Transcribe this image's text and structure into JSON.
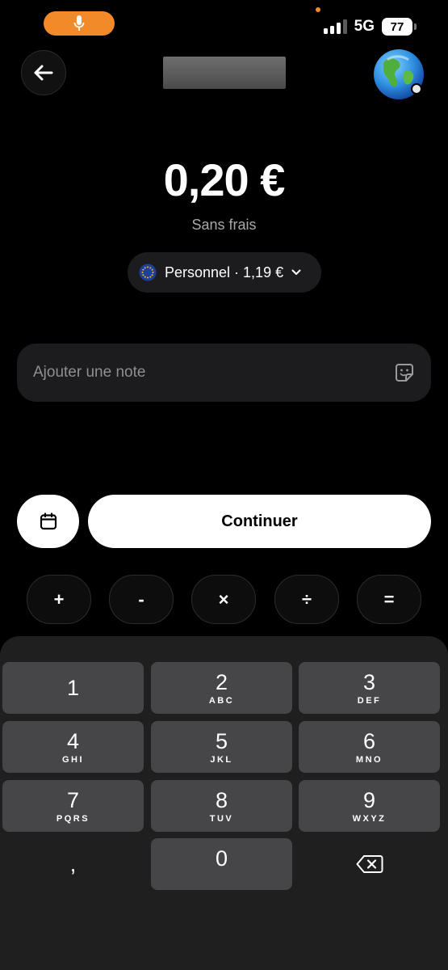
{
  "status_bar": {
    "network": "5G",
    "battery": "77",
    "mic_active_color": "#f28a2a"
  },
  "header": {
    "back_icon": "arrow-left-icon",
    "avatar_icon": "globe-icon"
  },
  "amount": {
    "value": "0,20 €",
    "fees_label": "Sans frais"
  },
  "account": {
    "flag_icon": "eu-flag-icon",
    "label": "Personnel · 1,19 €",
    "chevron_icon": "chevron-down-icon"
  },
  "note": {
    "placeholder": "Ajouter une note",
    "sticker_icon": "sticker-icon"
  },
  "actions": {
    "calendar_icon": "calendar-icon",
    "continue_label": "Continuer"
  },
  "operators": [
    "+",
    "-",
    "×",
    "÷",
    "="
  ],
  "keypad": {
    "keys": [
      {
        "digit": "1",
        "letters": ""
      },
      {
        "digit": "2",
        "letters": "ABC"
      },
      {
        "digit": "3",
        "letters": "DEF"
      },
      {
        "digit": "4",
        "letters": "GHI"
      },
      {
        "digit": "5",
        "letters": "JKL"
      },
      {
        "digit": "6",
        "letters": "MNO"
      },
      {
        "digit": "7",
        "letters": "PQRS"
      },
      {
        "digit": "8",
        "letters": "TUV"
      },
      {
        "digit": "9",
        "letters": "WXYZ"
      },
      {
        "digit": ",",
        "letters": ""
      },
      {
        "digit": "0",
        "letters": ""
      }
    ],
    "delete_icon": "backspace-icon"
  }
}
